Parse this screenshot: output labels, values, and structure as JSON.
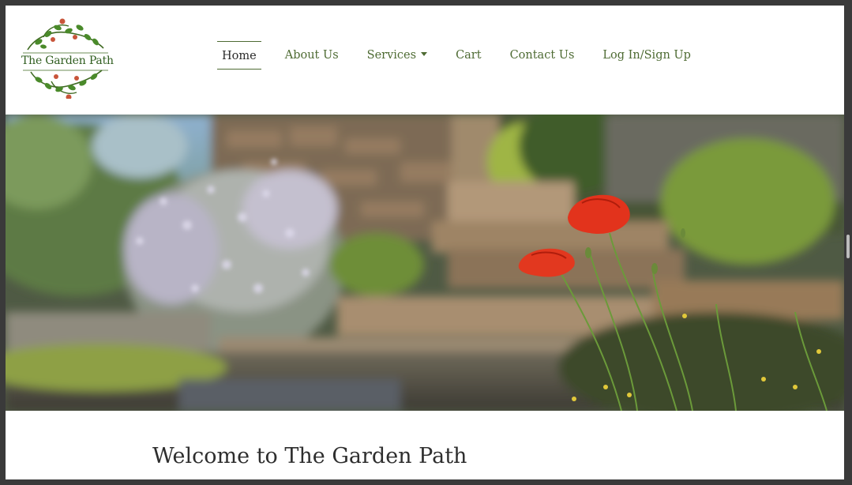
{
  "site": {
    "logo_text": "The Garden Path",
    "brand_color": "#4e6b33"
  },
  "nav": {
    "items": [
      {
        "label": "Home",
        "active": true
      },
      {
        "label": "About Us"
      },
      {
        "label": "Services",
        "has_dropdown": true
      },
      {
        "label": "Cart"
      },
      {
        "label": "Contact Us"
      },
      {
        "label": "Log In/Sign Up"
      }
    ]
  },
  "hero": {
    "image_subject": "stone garden steps with red poppies"
  },
  "main": {
    "heading": "Welcome to The Garden Path"
  }
}
